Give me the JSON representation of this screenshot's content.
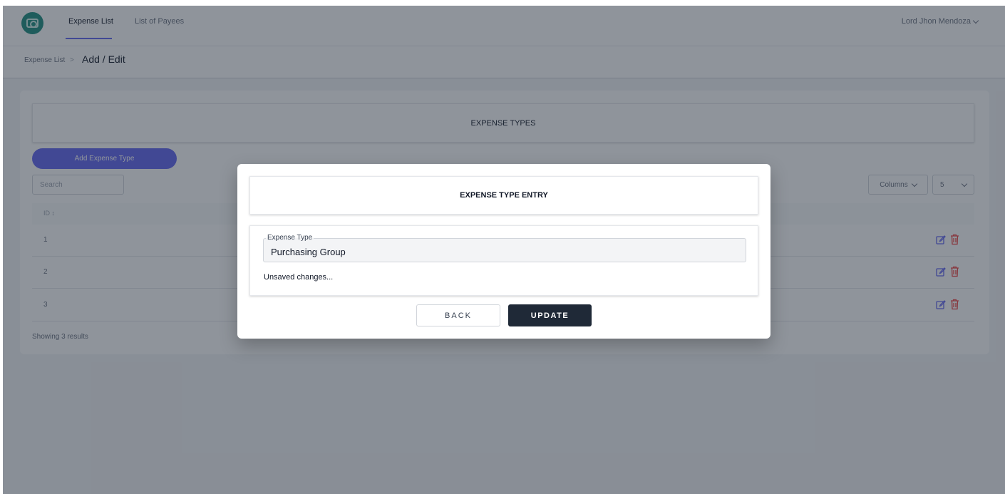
{
  "nav": {
    "tabs": [
      {
        "label": "Expense List",
        "active": true
      },
      {
        "label": "List of Payees",
        "active": false
      }
    ],
    "user_name": "Lord Jhon Mendoza"
  },
  "breadcrumb": {
    "parent": "Expense List",
    "separator": ">",
    "current": "Add / Edit"
  },
  "page": {
    "section_title": "EXPENSE TYPES",
    "add_button_label": "Add Expense Type",
    "search_placeholder": "Search",
    "columns_label": "Columns",
    "per_page": "5",
    "table_header_id": "ID ↕",
    "rows": [
      {
        "id": "1"
      },
      {
        "id": "2"
      },
      {
        "id": "3"
      }
    ],
    "results_text": "Showing 3 results"
  },
  "modal": {
    "title": "EXPENSE TYPE ENTRY",
    "field_label": "Expense Type",
    "field_value": "Purchasing Group",
    "status_text": "Unsaved changes...",
    "back_label": "BACK",
    "update_label": "UPDATE"
  },
  "colors": {
    "accent": "#6366f1",
    "overlay": "rgba(31,41,55,0.5)",
    "update_button": "#1f2937",
    "delete_icon": "#ef4444",
    "edit_icon": "#6366f1"
  }
}
